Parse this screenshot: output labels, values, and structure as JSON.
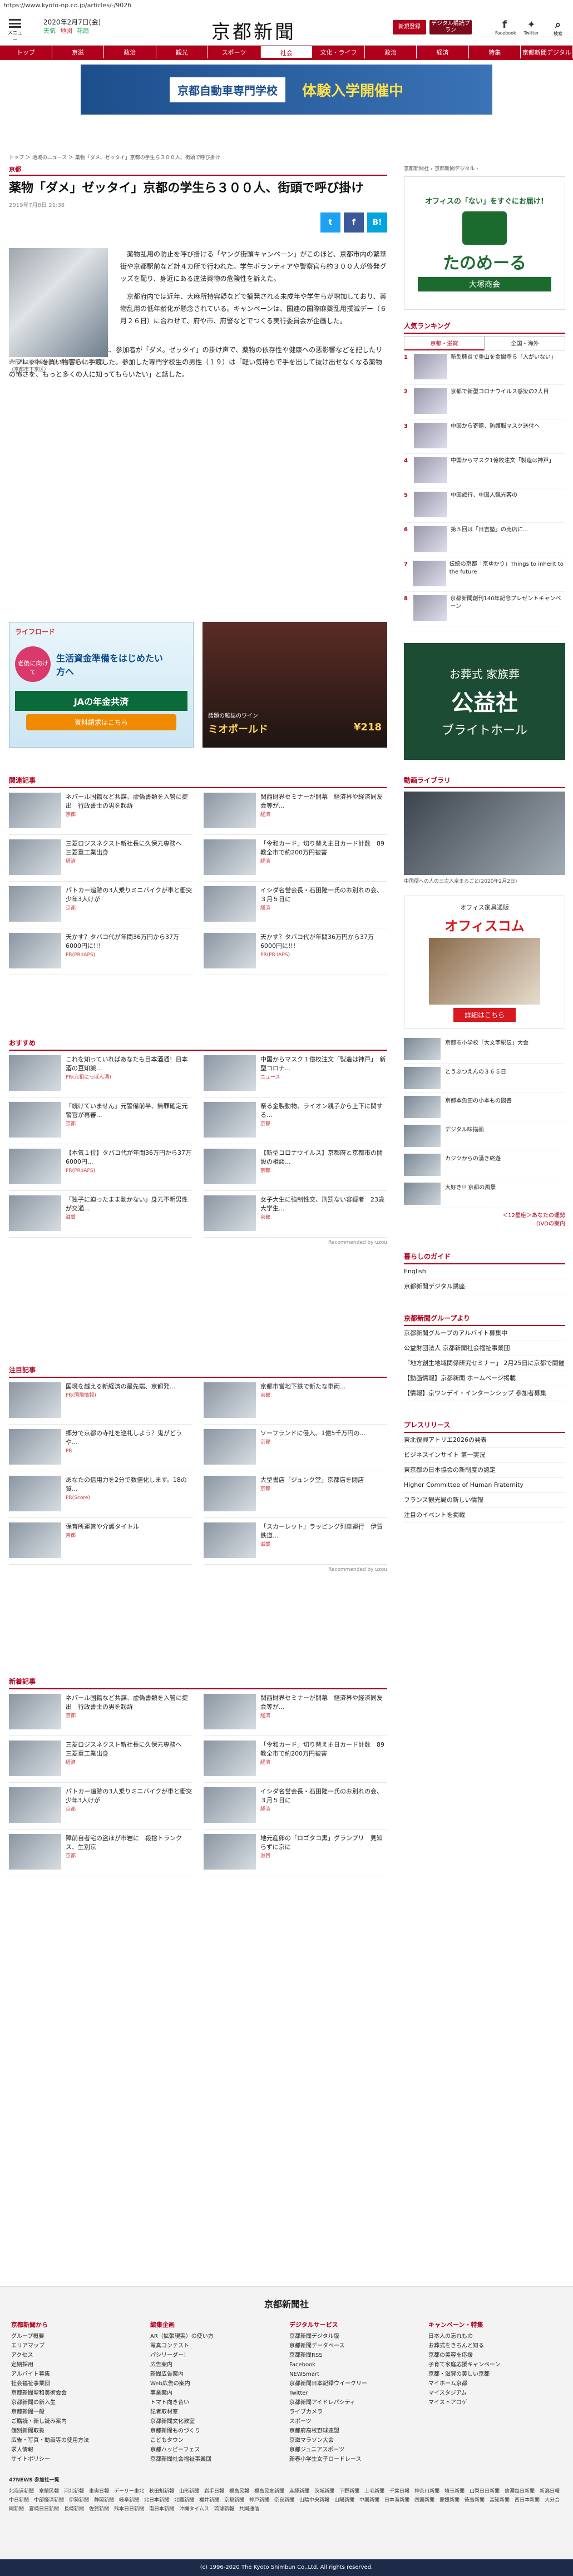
{
  "url": "https://www.kyoto-np.co.jp/articles/-/9026",
  "header": {
    "date": "2020年2月7日(金)",
    "weather": [
      "天気",
      "地図",
      "花扇"
    ],
    "logo": "京都新聞",
    "btn1": "新規登録",
    "btn2": "デジタル購読プラン",
    "icons": [
      "Facebook",
      "Twitter",
      "検索"
    ],
    "menu": "メニュー"
  },
  "nav": [
    "トップ",
    "京滋",
    "政治",
    "観光",
    "スポーツ",
    "社会",
    "文化・ライフ",
    "政治",
    "経済",
    "特集",
    "京都新聞デジタル"
  ],
  "topad": {
    "left": "京都自動車専門学校",
    "right": "体験入学開催中"
  },
  "breadcrumb": "トップ ＞ 地域のニュース ＞ 薬物「ダメ、ゼッタイ」京都の学生ら３００人、街頭で呼び掛け",
  "article": {
    "section": "京都",
    "title": "薬物「ダメ」ゼッタイ」京都の学生ら３００人、街頭で呼び掛け",
    "published": "2019年7月8日 21:38",
    "photo_caption": "通行人に薬物乱用防止を呼び掛ける学生ら（京都市下京区）",
    "p1": "薬物乱用の防止を呼び掛ける「ヤング街頭キャンペーン」がこのほど、京都市内の繁華街や京都駅前など計４カ所で行われた。学生ボランティアや警察官ら約３００人が啓発グッズを配り、身近にある違法薬物の危険性を訴えた。",
    "p2": "京都府内では近年、大麻所持容疑などで摘発される未成年や学生らが増加しており、薬物乱用の低年齢化が懸念されている。キャンペーンは、国連の国際麻薬乱用撲滅デー（６月２６日）に合わせて、府や市、府警などでつくる実行委員会が企画した。",
    "p3": "下京区の四条河原町交差点では、参加者が「ダメ。ゼッタイ」の掛け声で、薬物の依存性や健康への悪影響などを記したリーフレットを買い物客らに手渡した。参加した専門学校生の男性（１９）は「軽い気持ちで手を出して抜け出せなくなる薬物の怖さを、もっと多くの人に知ってもらいたい」と話した。"
  },
  "share": [
    "t",
    "f",
    "B!"
  ],
  "ads2": {
    "a_left": "ライフロード",
    "a_mid": "老後に向けて",
    "a_main": "生活資金準備をはじめたい方へ",
    "a_bot": "JAの年金共済",
    "a_btn": "資料請求はこちら",
    "b_text": "話題の雑誌のワイン",
    "b_name": "ミオポールド",
    "b_price": "¥218"
  },
  "related": {
    "heading": "関連記事",
    "items": [
      {
        "t": "ネパール国籍など共謀、虚偽書類を入管に提出　行政書士の男を起訴",
        "tag": "京都"
      },
      {
        "t": "関西財界セミナーが開幕　経済界や経済同友会等が...",
        "tag": "経済"
      },
      {
        "t": "三菱ロジスネクスト新社長に久保元専務へ　三菱重工業出身",
        "tag": "経済"
      },
      {
        "t": "「令和カード」切り替え主日カード計数　89教全市で約200万円被害",
        "tag": "経済"
      },
      {
        "t": "パトカー追跡の3人乗りミニバイクが車と衝突　少年3人けが",
        "tag": "京都"
      },
      {
        "t": "イシダ名誉会長・石田隆一氏のお別れの会、３月５日に",
        "tag": "経済"
      },
      {
        "t": "天かす？タバコ代が年間36万円から37万6000円に!!!",
        "tag": "PR(PR:IAPS)"
      },
      {
        "t": "天かす？タバコ代が年間36万円から37万6000円に!!!",
        "tag": "PR(PR:IAPS)"
      }
    ]
  },
  "recommend": {
    "heading": "おすすめ",
    "items": [
      {
        "t": "これを知っていればあなたも目本酒通！日本酒の豆知識...",
        "tag": "PR(元祖にっぽん酒)"
      },
      {
        "t": "中国からマスク１億枚注文「製造は神戸」　新型コロナ...",
        "tag": "ニュース"
      },
      {
        "t": "「続けていません」元警備前半、無罪確定元警官が再審...",
        "tag": "京都"
      },
      {
        "t": "祭る金製動物、ライオン親子から上下に関する...",
        "tag": "京都"
      },
      {
        "t": "【本気１位】タバコ代が年間36万円から37万6000円...",
        "tag": "PR(PR:IAPS)"
      },
      {
        "t": "【新型コロナウイルス】京都府と京都市の開設の相談...",
        "tag": "京都"
      },
      {
        "t": "「独子に迫ったまま動かない」身元不明男性が交通...",
        "tag": "滋賀"
      },
      {
        "t": "女子大生に強制性交、刑罰ない容疑者　23歳大学生...",
        "tag": "京都"
      }
    ],
    "credit": "Recommended by uzou"
  },
  "featured": {
    "heading": "注目記事",
    "items": [
      {
        "t": "国境を越える新経済の最先端、京都発...",
        "tag": "PR(国際情報)"
      },
      {
        "t": "京都市営地下鉄で新たな車両...",
        "tag": "京都"
      },
      {
        "t": "郷分で京都の寺社を巡礼しよう？鬼がどうや...",
        "tag": "PR"
      },
      {
        "t": "ソーフランドに侵入、1億5千万円の...",
        "tag": "京都"
      },
      {
        "t": "あなたの信用力を2分で数値化します。18の質...",
        "tag": "PR(Score)"
      },
      {
        "t": "大型書店「ジュンク堂」京都店を閉店",
        "tag": "京都"
      },
      {
        "t": "保育所運営や介護タイトル",
        "tag": "京都"
      },
      {
        "t": "「スカーレット」ラッピング列車運行　伊賀鉄道...",
        "tag": "滋賀"
      }
    ],
    "credit": "Recommended by uzou"
  },
  "latest": {
    "heading": "新着記事",
    "items": [
      {
        "t": "ネパール国籍など共謀、虚偽書類を入管に提出　行政書士の男を起訴",
        "tag": "京都"
      },
      {
        "t": "関西財界セミナーが開幕　経済界や経済同友会等が...",
        "tag": "経済"
      },
      {
        "t": "三菱ロジスネクスト新社長に久保元専務へ　三菱重工業出身",
        "tag": "経済"
      },
      {
        "t": "「令和カード」切り替え主日カード計数　89教全市で約200万円被害",
        "tag": "経済"
      },
      {
        "t": "パトカー追跡の3人乗りミニバイクが車と衝突　少年3人けが",
        "tag": "京都"
      },
      {
        "t": "イシダ名誉会長・石田隆一氏のお別れの会、３月５日に",
        "tag": "経済"
      },
      {
        "t": "障前自者宅の盗ほが市岩に　殺捨トランクス、生別京",
        "tag": "京都"
      },
      {
        "t": "地元産卵の「ロゴタコ黒」グランプリ　見知らずに京に",
        "tag": "滋賀"
      }
    ]
  },
  "side": {
    "ad1_top": "オフィスの「ない」をすぐにお届け!",
    "ad1_brand": "たのめーる",
    "ad1_sub": "大塚商会",
    "rank_heading": "人気ランキング",
    "rank_tabs": [
      "京都・滋賀",
      "全国・海外"
    ],
    "ranks": [
      {
        "n": "1",
        "t": "新型肺炎で重山を金閣寺ら「入がいない」"
      },
      {
        "n": "2",
        "t": "京都で新型コロナウイルス感染の2人目"
      },
      {
        "n": "3",
        "t": "中国から寄贈、防護服マスク送付へ"
      },
      {
        "n": "4",
        "t": "中国からマスク1億枚注文「製造は神戸」"
      },
      {
        "n": "5",
        "t": "中国旅行、中国人観光客の"
      },
      {
        "n": "6",
        "t": "第５回は「日吉塾」の売店に..."
      },
      {
        "n": "7",
        "t": "伝統の京都「京ゆかり」Things to inherit to the future"
      },
      {
        "n": "8",
        "t": "京都新聞創刊140年記念プレゼントキャンペーン"
      }
    ],
    "ad2_a": "お葬式 家族葬",
    "ad2_b": "公益社",
    "ad2_c": "ブライトホール",
    "video_heading": "動画ライブラリ",
    "video_cap": "中国便への人の三次入京まるごと(2020年2月2日)",
    "ad3_a": "オフィス家具通販",
    "ad3_b": "オフィスコム",
    "ad3_c": "詳細はこちら",
    "vids": [
      {
        "t": "京都市小学校「大文字駅伝」大会"
      },
      {
        "t": "とうぶつえんの３６５日"
      },
      {
        "t": "京都本魚田の小本もの図書"
      },
      {
        "t": "デジタル味描画"
      },
      {
        "t": "カジツからの湧き終遊"
      },
      {
        "t": "大好き!! 京都の風景"
      }
    ],
    "more": "＜12星座＞あなたの運勢",
    "ad4": "DVDの案内",
    "guide_heading": "暮らしのガイド",
    "guide": [
      "English",
      "京都新聞デジタル講座"
    ],
    "company_heading": "京都新聞グループより",
    "company": [
      "京都新聞グループのアルバイト募集中",
      "公益財団法人 京都新聞社会福祉事業団",
      "「地方創生地域関係研究セミナー」 2月25日に京都で開催",
      "【動画情報】京都新聞 ホームページ掲載",
      "【情報】京ワンデイ・インターンシップ 参加者募集"
    ],
    "press_heading": "プレスリリース",
    "press": [
      "東北復興アトリエ2026の発表",
      "ビジネスインサイト 第一実況",
      "東京都の日本協会の新制度の認定",
      "Higher Committee of Human Fraternity",
      "フランス観光局の新しい情報",
      "注目のイベントを掲載"
    ]
  },
  "footer": {
    "brand": "京都新聞社",
    "col1_head": "京都新聞から",
    "col1": [
      "グループ概要",
      "エリアマップ",
      "アクセス",
      "定期採用",
      "アルバイト募集",
      "社会福祉事業団",
      "京都新聞聖和美術会会",
      "京都新聞の新入生",
      "京都新聞一般",
      "ご購読・新し読み案内",
      "個別新聞取扱",
      "広告・写真・動画等の使用方法",
      "求人情報",
      "サイトポリシー"
    ],
    "col2_head": "編集企画",
    "col2": [
      "AR（拡張現実）の使い方",
      "写真コンテスト",
      "パシリーダー！",
      "広告案内",
      "新聞広告案内",
      "Web広告の案内",
      "事業案内",
      "トマト向き合い",
      "記者取材室",
      "京都新聞文化教室",
      "京都新聞ものづくり",
      "こどもタウン",
      "京都ハッピーフェス",
      "京都新聞社会福祉事業団"
    ],
    "col3_head": "デジタルサービス",
    "col3": [
      "京都新聞デジタル版",
      "京都新聞データベース",
      "京都新聞RSS",
      "Facebook",
      "NEWSmart",
      "京都新聞日本記録ウイークリー",
      "Twitter",
      "京都新聞アイドレパシティ",
      "ライブカメラ",
      "スポーツ",
      "京都府高校野球連盟",
      "京滋マラソン大会",
      "京都ジュニアスポーツ",
      "新春小学生女子ロードレース"
    ],
    "col4_head": "キャンペーン・特集",
    "col4": [
      "日本人の忘れもの",
      "お葬式をきちんと知る",
      "京都の美容を応援",
      "子育て家庭応援キャンペーン",
      "京都・滋賀の美しい京都",
      "マイホーム京都",
      "マイスタジアム",
      "マイストアロゲ"
    ],
    "network_heading": "47NEWS 参加社一覧",
    "network": "北海道新聞　室蘭民報　河北新報　東奥日報　デーリー東北　秋田魁新報　山形新聞　岩手日報　福島民報　福島民友新聞　産経新聞　茨城新聞　下野新聞　上毛新聞　千葉日報　神奈川新聞　埼玉新聞　山梨日日新聞　信濃毎日新聞　新潟日報　中日新聞　中部経済新聞　伊勢新聞　静岡新聞　岐阜新聞　北日本新聞　北國新聞　福井新聞　京都新聞　神戸新聞　奈良新聞　山陰中央新報　山陽新聞　中国新聞　日本海新聞　四国新聞　愛媛新聞　徳島新聞　高知新聞　西日本新聞　大分合同新聞　宮崎日日新聞　長崎新聞　佐賀新聞　熊本日日新聞　南日本新聞　沖縄タイムス　琉球新報　共同通信",
    "copyright": "(c) 1996-2020 The Kyoto Shimbun Co.,Ltd. All rights reserved."
  }
}
